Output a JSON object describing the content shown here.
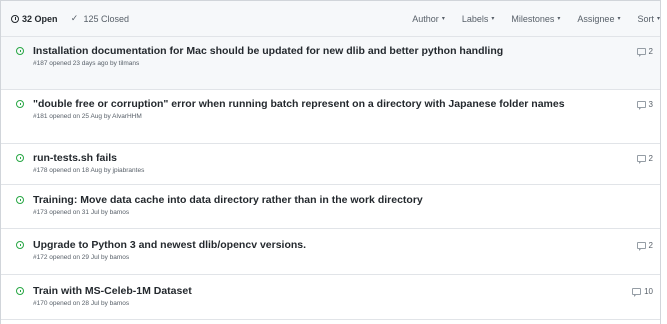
{
  "header": {
    "open_count": "32 Open",
    "closed_count": "125 Closed",
    "filters": [
      {
        "label": "Author"
      },
      {
        "label": "Labels"
      },
      {
        "label": "Milestones"
      },
      {
        "label": "Assignee"
      },
      {
        "label": "Sort"
      }
    ],
    "caret_glyph": "▾"
  },
  "issues": [
    {
      "title": "Installation documentation for Mac should be updated for new dlib and better python handling",
      "meta": "#187 opened 23 days ago by tilmans",
      "comments": "2",
      "highlight": true
    },
    {
      "title": "\"double free or corruption\" error when running batch represent on a directory with Japanese folder names",
      "meta": "#181 opened on 25 Aug by AlvarHHM",
      "comments": "3",
      "highlight": false
    },
    {
      "title": "run-tests.sh fails",
      "meta": "#178 opened on 18 Aug by jpiabrantes",
      "comments": "2",
      "highlight": false
    },
    {
      "title": "Training: Move data cache into data directory rather than in the work directory",
      "meta": "#173 opened on 31 Jul by bamos",
      "comments": "",
      "highlight": false
    },
    {
      "title": "Upgrade to Python 3 and newest dlib/opencv versions.",
      "meta": "#172 opened on 29 Jul by bamos",
      "comments": "2",
      "highlight": false
    },
    {
      "title": "Train with MS-Celeb-1M Dataset",
      "meta": "#170 opened on 28 Jul by bamos",
      "comments": "10",
      "highlight": false
    }
  ],
  "colors": {
    "open_green": "#28a745",
    "header_bg": "#f6f8fa",
    "border": "#e1e4e8",
    "muted_text": "#586069"
  }
}
